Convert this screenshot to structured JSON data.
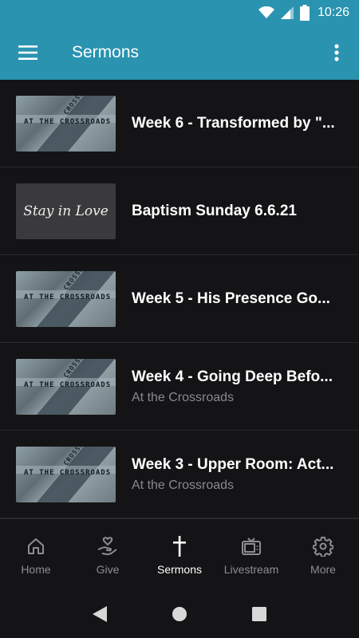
{
  "status_bar": {
    "time": "10:26"
  },
  "app_bar": {
    "title": "Sermons"
  },
  "sermons": [
    {
      "title": "Week 6 - Transformed by \"...",
      "subtitle": "",
      "thumbnail": "crossroads"
    },
    {
      "title": "Baptism Sunday 6.6.21",
      "subtitle": "",
      "thumbnail": "stay-in-love"
    },
    {
      "title": "Week 5 - His Presence Go...",
      "subtitle": "",
      "thumbnail": "crossroads"
    },
    {
      "title": "Week 4 - Going Deep Befo...",
      "subtitle": "At the Crossroads",
      "thumbnail": "crossroads"
    },
    {
      "title": "Week 3 - Upper Room: Act...",
      "subtitle": "At the Crossroads",
      "thumbnail": "crossroads"
    }
  ],
  "thumbnails": {
    "crossroads_text": "AT THE CROSSROADS",
    "crossroads_text_diag": "CROSSROADS",
    "love_text": "Stay in Love"
  },
  "bottom_nav": [
    {
      "label": "Home",
      "icon": "home-icon",
      "active": false
    },
    {
      "label": "Give",
      "icon": "give-icon",
      "active": false
    },
    {
      "label": "Sermons",
      "icon": "cross-icon",
      "active": true
    },
    {
      "label": "Livestream",
      "icon": "tv-icon",
      "active": false
    },
    {
      "label": "More",
      "icon": "gear-icon",
      "active": false
    }
  ],
  "colors": {
    "app_bar": "#2a93b0",
    "background": "#141416",
    "inactive_nav": "#8e8e92"
  }
}
